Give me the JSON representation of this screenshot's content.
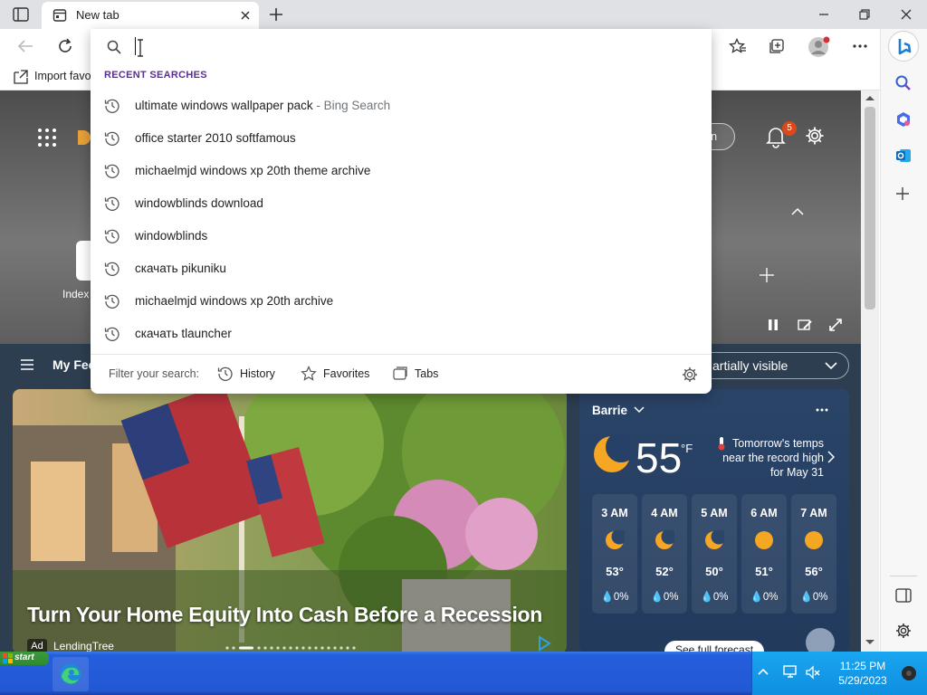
{
  "browser": {
    "tab_title": "New tab",
    "favorites_bar": {
      "import_label": "Import favo"
    }
  },
  "page": {
    "sign_in_label": "gn in",
    "notifications_count": "5",
    "shortcut_label": "Index",
    "my_feed_label": "My Fee",
    "visibility_label": "artially visible"
  },
  "news": {
    "headline": "Turn Your Home Equity Into Cash Before a Recession",
    "ad_badge": "Ad",
    "sponsor": "LendingTree"
  },
  "weather": {
    "location": "Barrie",
    "temperature": "55",
    "unit": "°F",
    "alert": "Tomorrow's temps near the record high for May 31",
    "see_forecast": "See full forecast",
    "hourly": [
      {
        "time": "3 AM",
        "temp": "53°",
        "precip": "0%",
        "icon": "moon"
      },
      {
        "time": "4 AM",
        "temp": "52°",
        "precip": "0%",
        "icon": "moon"
      },
      {
        "time": "5 AM",
        "temp": "50°",
        "precip": "0%",
        "icon": "moon"
      },
      {
        "time": "6 AM",
        "temp": "51°",
        "precip": "0%",
        "icon": "sun"
      },
      {
        "time": "7 AM",
        "temp": "56°",
        "precip": "0%",
        "icon": "sun"
      }
    ]
  },
  "dropdown": {
    "section_header": "RECENT SEARCHES",
    "items": [
      {
        "text": "ultimate windows wallpaper pack",
        "suffix": " - Bing Search"
      },
      {
        "text": "office starter 2010 softfamous",
        "suffix": ""
      },
      {
        "text": "michaelmjd windows xp 20th theme archive",
        "suffix": ""
      },
      {
        "text": "windowblinds download",
        "suffix": ""
      },
      {
        "text": "windowblinds",
        "suffix": ""
      },
      {
        "text": "скачать pikuniku",
        "suffix": ""
      },
      {
        "text": "michaelmjd windows xp 20th archive",
        "suffix": ""
      },
      {
        "text": "скачать tlauncher",
        "suffix": ""
      }
    ],
    "filter_label": "Filter your search:",
    "filters": [
      "History",
      "Favorites",
      "Tabs"
    ]
  },
  "taskbar": {
    "start_label": "start",
    "time": "11:25 PM",
    "date": "5/29/2023"
  },
  "colors": {
    "accent": "#5c2d91",
    "taskbar_blue": "#245edc",
    "tray_blue": "#0f8ee0",
    "weather_bg": "#2a4468"
  }
}
